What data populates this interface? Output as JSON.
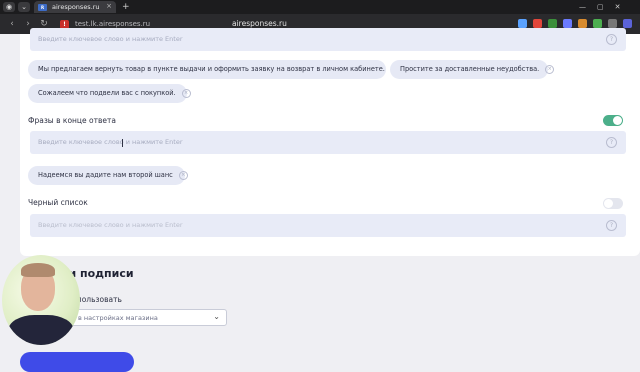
{
  "browser": {
    "tab_title": "airesponses.ru",
    "tab_favicon_text": "R",
    "url": "test.lk.airesponses.ru",
    "page_title": "airesponses.ru",
    "new_tab_symbol": "+",
    "extensions": [
      {
        "name": "puzzle-ext-icon",
        "color": "#5aa2ff"
      },
      {
        "name": "shield-ext-icon",
        "color": "#e2463b"
      },
      {
        "name": "camera-ext-icon",
        "color": "#3b8f3b"
      },
      {
        "name": "chat-ext-icon",
        "color": "#6b7bff"
      },
      {
        "name": "fox-ext-icon",
        "color": "#d88b2e"
      },
      {
        "name": "qr-ext-icon",
        "color": "#4caf50"
      },
      {
        "name": "cat-ext-icon",
        "color": "#777777"
      },
      {
        "name": "profile-ext-icon",
        "color": "#5b63d8"
      }
    ]
  },
  "top_field": {
    "placeholder": "Введите ключевое слово и нажмите Enter"
  },
  "top_chips": [
    "Мы предлагаем вернуть товар в пункте выдачи и оформить заявку на возврат в личном кабинете.",
    "Простите за доставленные неудобства.",
    "Сожалеем что подвели вас с покупкой."
  ],
  "end_phrases": {
    "label": "Фразы в конце ответа",
    "enabled": true,
    "placeholder": "Введите ключевое слово и нажмите Enter",
    "chips": [
      "Надеемся вы дадите нам второй шанс"
    ]
  },
  "blacklist": {
    "label": "Черный список",
    "enabled": false,
    "placeholder": "Введите ключевое слово и нажмите Enter"
  },
  "signature": {
    "heading": "ки подписи",
    "use_label": "ь использовать",
    "select_value": "в настройках магазина"
  },
  "colors": {
    "accent_toggle": "#4caf8a",
    "toggle_off": "#e4e6ee",
    "primary_button": "#3f4be8"
  },
  "icons": {
    "help": "?",
    "remove": "×",
    "chevron": "⌄"
  }
}
